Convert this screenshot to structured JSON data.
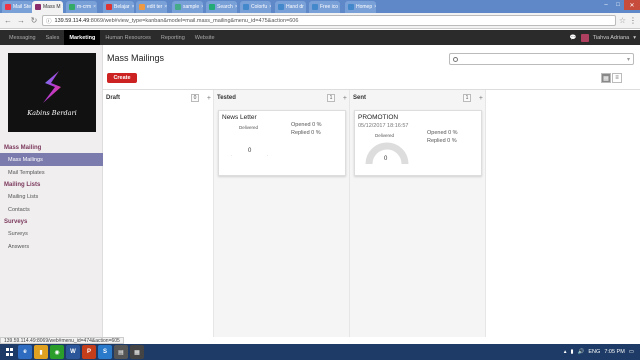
{
  "browser": {
    "tabs": [
      {
        "label": "Mail Ste",
        "favicon": "#e34"
      },
      {
        "label": "Mass M",
        "favicon": "#8a2b6b",
        "active": true
      },
      {
        "label": "m-crm",
        "favicon": "#3a6"
      },
      {
        "label": "Belajar",
        "favicon": "#d33"
      },
      {
        "label": "edit ter",
        "favicon": "#e94"
      },
      {
        "label": "sample",
        "favicon": "#4a8"
      },
      {
        "label": "Search",
        "favicon": "#2a7"
      },
      {
        "label": "Colorfu",
        "favicon": "#48c"
      },
      {
        "label": "Hand dr",
        "favicon": "#48c"
      },
      {
        "label": "Free ico",
        "favicon": "#48c"
      },
      {
        "label": "Homep",
        "favicon": "#48c"
      }
    ],
    "url_host": "139.59.114.49",
    "url_rest": ":8069/web#view_type=kanban&model=mail.mass_mailing&menu_id=475&action=606"
  },
  "topmenu": [
    "Messaging",
    "Sales",
    "Marketing",
    "Human Resources",
    "Reporting",
    "Website"
  ],
  "topmenu_active": 2,
  "user": {
    "name": "Tiahva Adriana"
  },
  "sidebar": {
    "logo_text": "Kabins Berdari",
    "sections": [
      {
        "title": "Mass Mailing",
        "items": [
          {
            "label": "Mass Mailings",
            "active": true
          },
          {
            "label": "Mail Templates"
          }
        ]
      },
      {
        "title": "Mailing Lists",
        "items": [
          {
            "label": "Mailing Lists"
          },
          {
            "label": "Contacts"
          }
        ]
      },
      {
        "title": "Surveys",
        "items": [
          {
            "label": "Surveys"
          },
          {
            "label": "Answers"
          }
        ]
      }
    ]
  },
  "control": {
    "title": "Mass Mailings",
    "create_label": "Create"
  },
  "columns": [
    {
      "title": "Draft",
      "count": "0"
    },
    {
      "title": "Tested",
      "count": "1"
    },
    {
      "title": "Sent",
      "count": "1"
    }
  ],
  "cards": {
    "tested": {
      "name": "News Letter",
      "gauge_label": "Delivered",
      "gauge_value": "0",
      "delivered_percent": 0,
      "opened": "Opened 0 %",
      "replied": "Replied 0 %"
    },
    "sent": {
      "name": "PROMOTION",
      "date": "05/12/2017 18:16:57",
      "gauge_label": "Delivered",
      "gauge_value": "0",
      "delivered_percent": 0,
      "opened": "Opened 0 %",
      "replied": "Replied 0 %"
    }
  },
  "status_url": "139.59.114.49:8069/web#menu_id=474&action=605",
  "taskbar": {
    "apps": [
      {
        "label": "e",
        "color": "#2d6cc0"
      },
      {
        "label": "▮",
        "color": "#e0a020"
      },
      {
        "label": "◉",
        "color": "#2a9d2a"
      },
      {
        "label": "W",
        "color": "#2b579a"
      },
      {
        "label": "P",
        "color": "#c43e1c"
      },
      {
        "label": "S",
        "color": "#2a7acc"
      },
      {
        "label": "▤",
        "color": "#555"
      },
      {
        "label": "▦",
        "color": "#444"
      }
    ],
    "lang": "ENG",
    "time": "7:05 PM"
  },
  "colors": {
    "accent": "#7c7bad",
    "create": "#cc2222",
    "brand": "#7c3a5e"
  }
}
